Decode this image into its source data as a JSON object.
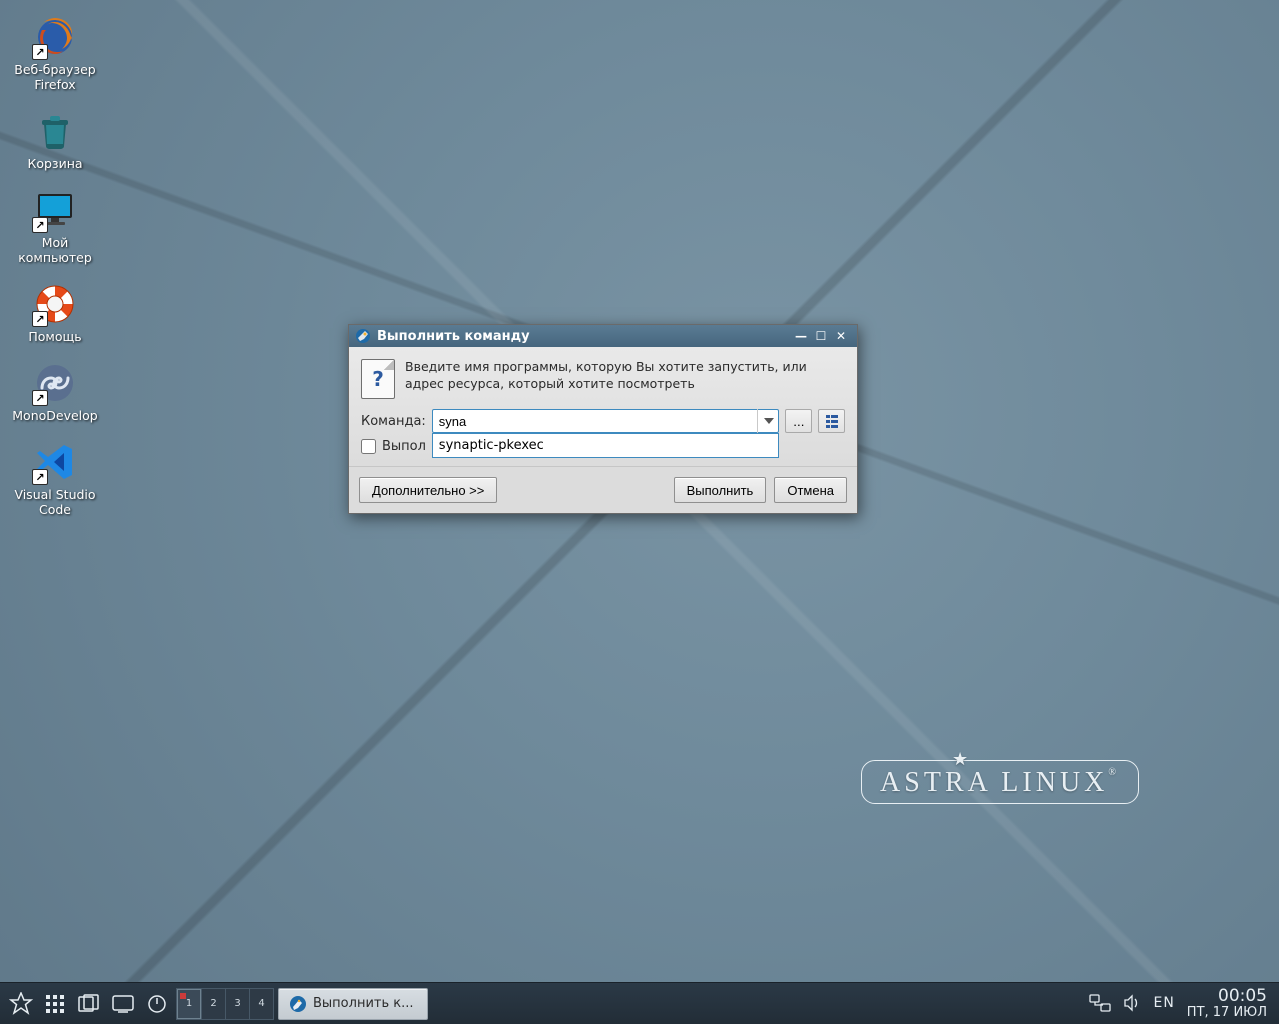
{
  "wallpaper": {
    "brand_text": "ASTRA LINUX"
  },
  "desktop_icons": [
    {
      "id": "firefox",
      "label": "Веб-браузер\nFirefox",
      "shortcut": true,
      "icon": "firefox"
    },
    {
      "id": "trash",
      "label": "Корзина",
      "shortcut": false,
      "icon": "trash"
    },
    {
      "id": "computer",
      "label": "Мой\nкомпьютер",
      "shortcut": true,
      "icon": "monitor"
    },
    {
      "id": "help",
      "label": "Помощь",
      "shortcut": true,
      "icon": "lifebuoy"
    },
    {
      "id": "monodev",
      "label": "MonoDevelop",
      "shortcut": true,
      "icon": "infinity"
    },
    {
      "id": "vscode",
      "label": "Visual Studio\nCode",
      "shortcut": true,
      "icon": "vscode"
    }
  ],
  "dialog": {
    "title": "Выполнить команду",
    "info_text": "Введите имя программы, которую Вы хотите запустить, или адрес ресурса, который хотите посмотреть",
    "command_label": "Команда:",
    "command_value": "syna",
    "autocomplete_option": "synaptic-pkexec",
    "checkbox_label_visible": "Выпол",
    "browse_button": "...",
    "more_button": "Дополнительно >>",
    "run_button": "Выполнить",
    "cancel_button": "Отмена"
  },
  "taskbar": {
    "pager": {
      "count": 4,
      "active": 1,
      "marked": 1
    },
    "task_item_label": "Выполнить к...",
    "lang": "EN",
    "time": "00:05",
    "date": "ПТ, 17 ИЮЛ"
  }
}
